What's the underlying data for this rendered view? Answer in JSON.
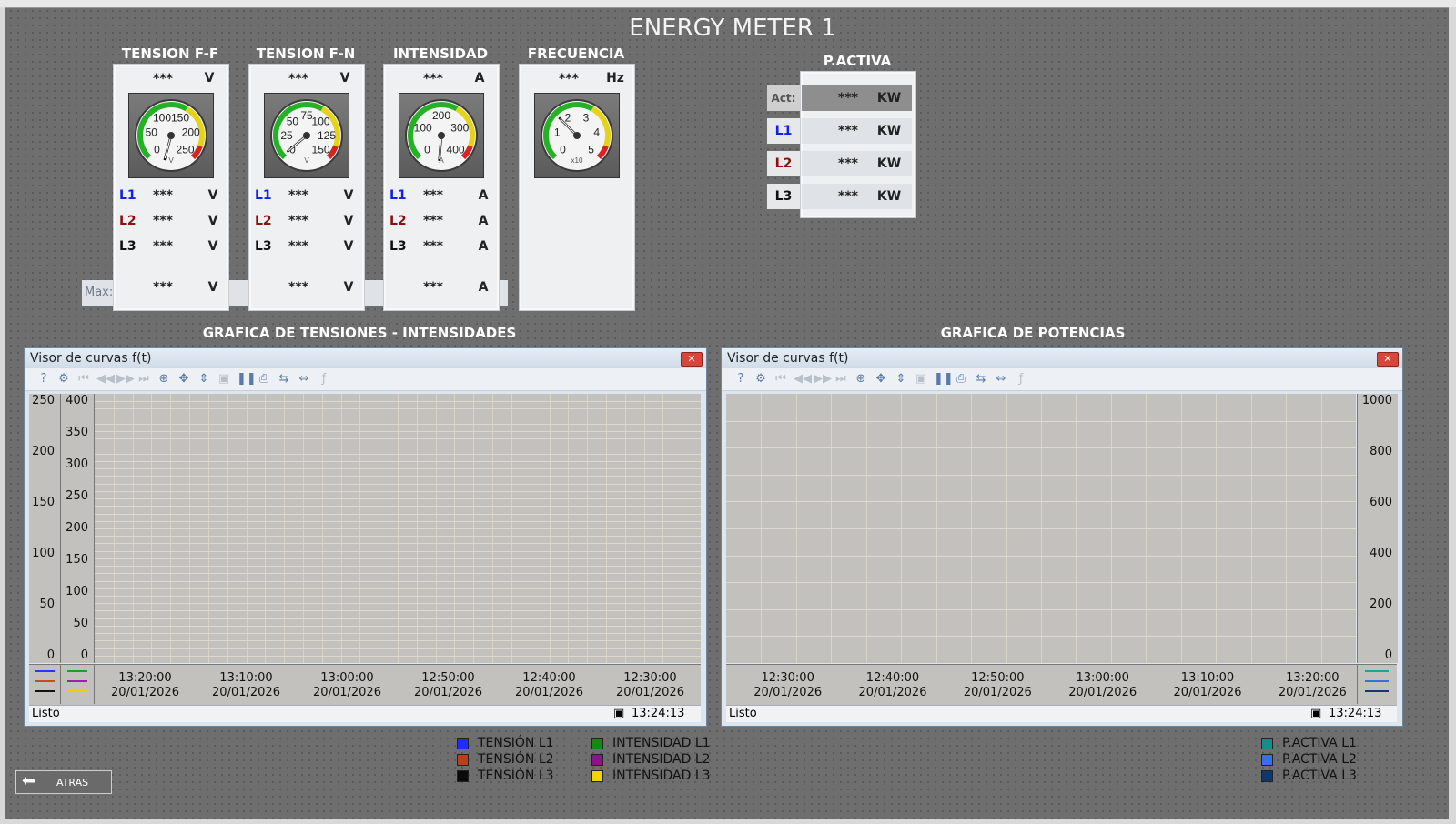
{
  "main_title": "ENERGY METER 1",
  "meters": [
    {
      "title": "TENSION F-F",
      "top_value": "***",
      "unit": "V",
      "ticks": [
        "0",
        "50",
        "100",
        "150",
        "200",
        "250"
      ],
      "gauge_unit": "V",
      "lines": [
        {
          "label": "L1",
          "value": "***",
          "unit": "V"
        },
        {
          "label": "L2",
          "value": "***",
          "unit": "V"
        },
        {
          "label": "L3",
          "value": "***",
          "unit": "V"
        }
      ],
      "max_value": "***",
      "max_unit": "V"
    },
    {
      "title": "TENSION F-N",
      "top_value": "***",
      "unit": "V",
      "ticks": [
        "0",
        "25",
        "50",
        "75",
        "100",
        "125",
        "150"
      ],
      "gauge_unit": "V",
      "lines": [
        {
          "label": "L1",
          "value": "***",
          "unit": "V"
        },
        {
          "label": "L2",
          "value": "***",
          "unit": "V"
        },
        {
          "label": "L3",
          "value": "***",
          "unit": "V"
        }
      ],
      "max_value": "***",
      "max_unit": "V"
    },
    {
      "title": "INTENSIDAD",
      "top_value": "***",
      "unit": "A",
      "ticks": [
        "0",
        "100",
        "200",
        "300",
        "400"
      ],
      "gauge_unit": "A",
      "lines": [
        {
          "label": "L1",
          "value": "***",
          "unit": "A"
        },
        {
          "label": "L2",
          "value": "***",
          "unit": "A"
        },
        {
          "label": "L3",
          "value": "***",
          "unit": "A"
        }
      ],
      "max_value": "***",
      "max_unit": "A"
    },
    {
      "title": "FRECUENCIA",
      "top_value": "***",
      "unit": "Hz",
      "ticks": [
        "0",
        "1",
        "2",
        "3",
        "4",
        "5"
      ],
      "gauge_unit": "x10"
    }
  ],
  "max_label": "Max:",
  "pactiva": {
    "title": "P.ACTIVA",
    "rows": [
      {
        "label": "Act:",
        "value": "***",
        "unit": "KW"
      },
      {
        "label": "L1",
        "value": "***",
        "unit": "KW"
      },
      {
        "label": "L2",
        "value": "***",
        "unit": "KW"
      },
      {
        "label": "L3",
        "value": "***",
        "unit": "KW"
      }
    ]
  },
  "chart_left": {
    "heading": "GRAFICA DE TENSIONES - INTENSIDADES",
    "window_title": "Visor de curvas f(t)",
    "close_label": "✕",
    "axis1": [
      "250",
      "200",
      "150",
      "100",
      "50",
      "0"
    ],
    "axis2": [
      "400",
      "350",
      "300",
      "250",
      "200",
      "150",
      "100",
      "50",
      "0"
    ],
    "x_times": [
      "13:20:00",
      "13:10:00",
      "13:00:00",
      "12:50:00",
      "12:40:00",
      "12:30:00"
    ],
    "x_date": "20/01/2026",
    "status": "Listo",
    "clock": "13:24:13",
    "legend_colors": [
      "#1e3cff",
      "#c84a1e",
      "#111111",
      "#1ea01e",
      "#a020a0",
      "#f0d000"
    ]
  },
  "chart_right": {
    "heading": "GRAFICA DE POTENCIAS",
    "window_title": "Visor de curvas f(t)",
    "close_label": "✕",
    "axis": [
      "1000",
      "800",
      "600",
      "400",
      "200",
      "0"
    ],
    "x_times": [
      "12:30:00",
      "12:40:00",
      "12:50:00",
      "13:00:00",
      "13:10:00",
      "13:20:00"
    ],
    "x_date": "20/01/2026",
    "status": "Listo",
    "clock": "13:24:13",
    "legend_colors": [
      "#20a0a0",
      "#3a6ee0",
      "#123a6a"
    ]
  },
  "legend_left": [
    {
      "label": "TENSIÓN L1",
      "color": "#1e2cff"
    },
    {
      "label": "TENSIÓN L2",
      "color": "#b8401a"
    },
    {
      "label": "TENSIÓN L3",
      "color": "#0a0a0a"
    }
  ],
  "legend_mid": [
    {
      "label": "INTENSIDAD L1",
      "color": "#148a14"
    },
    {
      "label": "INTENSIDAD L2",
      "color": "#8a148a"
    },
    {
      "label": "INTENSIDAD L3",
      "color": "#f2d400"
    }
  ],
  "legend_right": [
    {
      "label": "P.ACTIVA L1",
      "color": "#1a8a8a"
    },
    {
      "label": "P.ACTIVA L2",
      "color": "#3a6ee8"
    },
    {
      "label": "P.ACTIVA L3",
      "color": "#0f3868"
    }
  ],
  "back_button": "ATRAS",
  "colors": {
    "l1": "#1020e8",
    "l2": "#8a1010",
    "l3": "#111111"
  }
}
